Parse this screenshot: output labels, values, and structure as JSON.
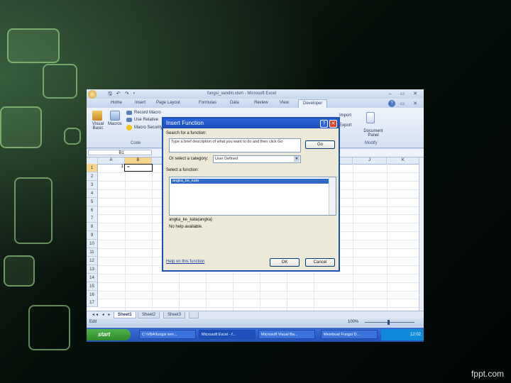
{
  "window": {
    "title": "fungsi_sendiri.xlsm - Microsoft Excel",
    "quick_access": "🖫 ↶ ↷ ▾",
    "controls": "– ▭ ✕"
  },
  "ribbon": {
    "tabs": [
      "Home",
      "Insert",
      "Page Layout",
      "Formulas",
      "Data",
      "Review",
      "View",
      "Developer"
    ],
    "active_tab": "Developer",
    "code_group": {
      "visual_basic": "Visual Basic",
      "macros": "Macros",
      "record_macro": "Record Macro",
      "use_relative": "Use Relative",
      "macro_security": "Macro Security",
      "label": "Code"
    },
    "xml_group": {
      "import": "Import",
      "export": "Export"
    },
    "modify_group": {
      "document_panel": "Document Panel",
      "label": "Modify"
    }
  },
  "formula_bar": {
    "name_box": "B1"
  },
  "sheet": {
    "columns": [
      "A",
      "B",
      "C",
      "D",
      "E",
      "F",
      "G",
      "H",
      "I",
      "J",
      "K"
    ],
    "rows": [
      "1",
      "2",
      "3",
      "4",
      "5",
      "6",
      "7",
      "8",
      "9",
      "10",
      "11",
      "12",
      "13",
      "14",
      "15",
      "16",
      "17"
    ],
    "a1_value": "1",
    "b1_value": "="
  },
  "sheet_tabs": [
    "Sheet1",
    "Sheet2",
    "Sheet3"
  ],
  "status": {
    "mode": "Edit",
    "zoom": "100%"
  },
  "taskbar": {
    "start": "start",
    "items": [
      "C:\\VBA\\fungsi sen...",
      "Microsoft Excel - f...",
      "Microsoft Visual Ba...",
      "Membuat Fungsi D..."
    ],
    "time": "12:02"
  },
  "dialog": {
    "title": "Insert Function",
    "help": "?",
    "close": "✕",
    "search_label": "Search for a function:",
    "search_text": "Type a brief description of what you want to do and then click Go",
    "go": "Go",
    "category_label": "Or select a category:",
    "category_value": "User Defined",
    "select_label": "Select a function:",
    "functions": [
      "angka_ke_kata"
    ],
    "signature": "angka_ke_kata(angka)",
    "description": "No help available.",
    "help_link": "Help on this function",
    "ok": "OK",
    "cancel": "Cancel"
  }
}
